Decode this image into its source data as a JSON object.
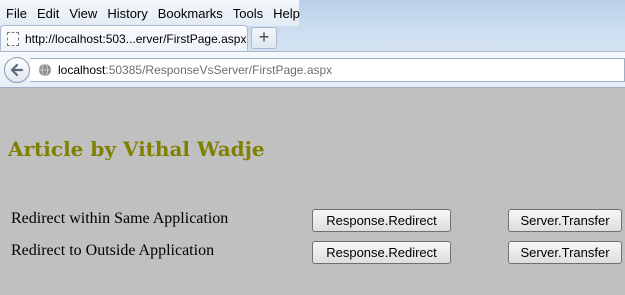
{
  "menubar": {
    "items": [
      "File",
      "Edit",
      "View",
      "History",
      "Bookmarks",
      "Tools",
      "Help"
    ]
  },
  "tab": {
    "title": "http://localhost:503...erver/FirstPage.aspx",
    "close": "×",
    "new_tab": "+"
  },
  "navbar": {
    "url_host": "localhost",
    "url_rest": ":50385/ResponseVsServer/FirstPage.aspx"
  },
  "page": {
    "heading": "Article by Vithal Wadje",
    "rows": [
      {
        "label": "Redirect within Same Application",
        "redirect_button": "Response.Redirect",
        "transfer_button": "Server.Transfer"
      },
      {
        "label": "Redirect to Outside Application",
        "redirect_button": "Response.Redirect",
        "transfer_button": "Server.Transfer"
      }
    ]
  },
  "colors": {
    "page_background": "#c0c0c0",
    "heading": "#808000"
  }
}
